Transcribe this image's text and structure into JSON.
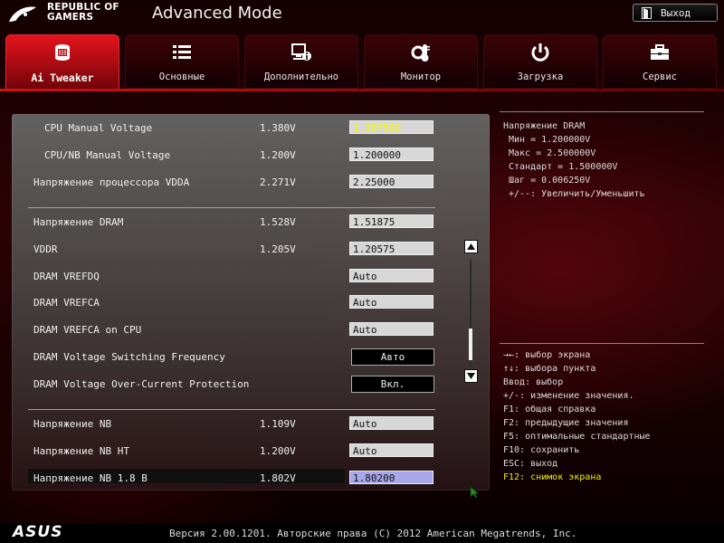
{
  "header": {
    "brand_line1": "REPUBLIC OF",
    "brand_line2": "GAMERS",
    "mode_title": "Advanced Mode",
    "exit_label": "Выход"
  },
  "tabs": [
    {
      "label": "Ai Tweaker",
      "icon": "ai-tweaker-icon",
      "active": true
    },
    {
      "label": "Основные",
      "icon": "list-icon",
      "active": false
    },
    {
      "label": "Дополнительно",
      "icon": "advanced-info-icon",
      "active": false
    },
    {
      "label": "Монитор",
      "icon": "thermometer-icon",
      "active": false
    },
    {
      "label": "Загрузка",
      "icon": "power-icon",
      "active": false
    },
    {
      "label": "Сервис",
      "icon": "toolbox-icon",
      "active": false
    }
  ],
  "settings": [
    {
      "label": "CPU Manual Voltage",
      "current": "1.380V",
      "value": "1.387500",
      "style": "hl"
    },
    {
      "label": "CPU/NB Manual Voltage",
      "current": "1.200V",
      "value": "1.200000",
      "style": ""
    },
    {
      "label": "Напряжение процессора VDDA",
      "current": "2.271V",
      "value": "2.25000",
      "style": ""
    },
    {
      "label": "Напряжение DRAM",
      "current": "1.528V",
      "value": "1.51875",
      "style": ""
    },
    {
      "label": "VDDR",
      "current": "1.205V",
      "value": "1.20575",
      "style": ""
    },
    {
      "label": "DRAM VREFDQ",
      "current": "",
      "value": "Auto",
      "style": ""
    },
    {
      "label": "DRAM VREFCA",
      "current": "",
      "value": "Auto",
      "style": ""
    },
    {
      "label": "DRAM VREFCA on CPU",
      "current": "",
      "value": "Auto",
      "style": ""
    },
    {
      "label": "DRAM Voltage Switching Frequency",
      "current": "",
      "value": "Авто",
      "style": "btn"
    },
    {
      "label": "DRAM Voltage Over-Current Protection",
      "current": "",
      "value": "Вкл.",
      "style": "btn"
    },
    {
      "label": "Напряжение NB",
      "current": "1.109V",
      "value": "Auto",
      "style": ""
    },
    {
      "label": "Напряжение NB HT",
      "current": "1.200V",
      "value": "Auto",
      "style": ""
    },
    {
      "label": "Напряжение NB 1.8 В",
      "current": "1.802V",
      "value": "1.80200",
      "style": "sel"
    }
  ],
  "info": {
    "title": "Напряжение DRAM",
    "min": "Мин = 1.200000V",
    "max": "Макс = 2.500000V",
    "standard": "Стандарт = 1.500000V",
    "step": "Шаг = 0.006250V",
    "hint": "+/--: Увеличить/Уменьшить"
  },
  "help": [
    {
      "text": "→←: выбор экрана",
      "yellow": false
    },
    {
      "text": "↑↓: выбора пункта",
      "yellow": false
    },
    {
      "text": "Ввод: выбор",
      "yellow": false
    },
    {
      "text": "+/-: изменение значения.",
      "yellow": false
    },
    {
      "text": "F1: общая справка",
      "yellow": false
    },
    {
      "text": "F2: предыдущие значения",
      "yellow": false
    },
    {
      "text": "F5: оптимальные стандартные",
      "yellow": false
    },
    {
      "text": "F10: сохранить",
      "yellow": false
    },
    {
      "text": "ESC: выход",
      "yellow": false
    },
    {
      "text": "F12: снимок экрана",
      "yellow": true
    }
  ],
  "footer": {
    "logo": "ASUS",
    "version": "Версия 2.00.1201. Авторские права (C) 2012 American Megatrends, Inc."
  },
  "colors": {
    "accent": "#d0111a",
    "highlight_text": "#f7f700",
    "selected_field": "#a7a7e9"
  }
}
